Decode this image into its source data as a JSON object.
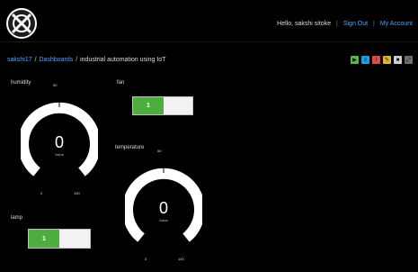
{
  "header": {
    "greeting": "Hello, sakshi sitoke",
    "sign_out": "Sign Out",
    "my_account": "My Account",
    "separator": "|"
  },
  "breadcrumb": {
    "user": "sakshi17",
    "section": "Dashboards",
    "title": "industrial automation using IoT",
    "slash": "/"
  },
  "toolbar": [
    {
      "name": "play-icon",
      "glyph": "▶",
      "color": "#58b847"
    },
    {
      "name": "sliders-icon",
      "glyph": "≡",
      "color": "#19a1e6"
    },
    {
      "name": "alert-icon",
      "glyph": "!",
      "color": "#e04a4a"
    },
    {
      "name": "wrench-icon",
      "glyph": "✎",
      "color": "#e0b329"
    },
    {
      "name": "lock-icon",
      "glyph": "■",
      "color": "#cfcfcf"
    },
    {
      "name": "expand-icon",
      "glyph": "⤢",
      "color": "#6f6f6f"
    }
  ],
  "widgets": {
    "humidity": {
      "label": "humidity",
      "value": "0",
      "unit": "Value",
      "min": "0",
      "max": "100",
      "top": "50"
    },
    "fan": {
      "label": "fan",
      "state": "1"
    },
    "temperature": {
      "label": "temperature",
      "value": "0",
      "unit": "Value",
      "min": "0",
      "max": "100",
      "top": "50"
    },
    "lamp": {
      "label": "lamp",
      "state": "1"
    }
  },
  "colors": {
    "background": "#000000",
    "link": "#4ea3ff",
    "gauge_track": "#ffffff",
    "switch_on": "#4cae3c",
    "switch_off": "#f2f2f2"
  }
}
